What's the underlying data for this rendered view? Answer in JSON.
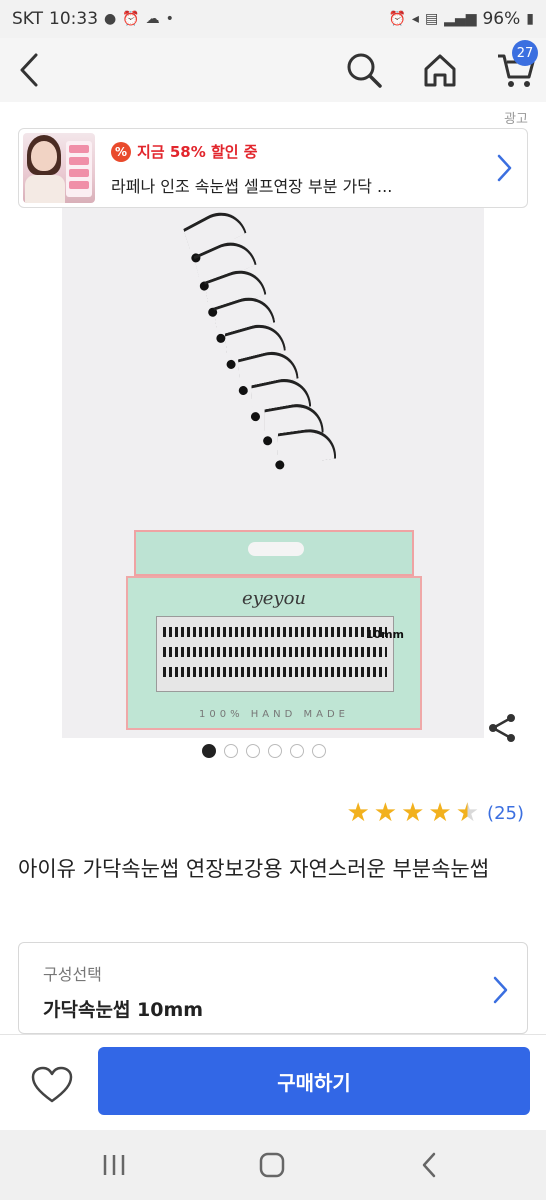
{
  "status_bar": {
    "carrier": "SKT",
    "time": "10:33",
    "battery": "96%"
  },
  "header": {
    "cart_count": "27"
  },
  "ad": {
    "label": "광고",
    "promo": "지금 58% 할인 중",
    "title": "라페나 인조 속눈썹 셀프연장 부분 가닥 ..."
  },
  "gallery": {
    "brand_text": "eyeyou",
    "size_text": "10mm",
    "made_text": "100% HAND MADE",
    "total_images": 6,
    "current_image": 1
  },
  "product": {
    "rating_stars": 4.5,
    "review_count": "(25)",
    "title": "아이유 가닥속눈썹 연장보강용 자연스러운 부분속눈썹"
  },
  "option": {
    "label": "구성선택",
    "value": "가닥속눈썹 10mm"
  },
  "bottom": {
    "buy_label": "구매하기"
  },
  "icons": [
    "back-icon",
    "search-icon",
    "home-icon",
    "cart-icon",
    "percent-icon",
    "chevron-right-icon",
    "share-icon",
    "heart-icon",
    "recents-icon",
    "home-nav-icon",
    "back-nav-icon"
  ],
  "colors": {
    "accent": "#3267e6",
    "star": "#f2b11e",
    "promo_red": "#e2262d",
    "badge": "#3b6fe0"
  }
}
